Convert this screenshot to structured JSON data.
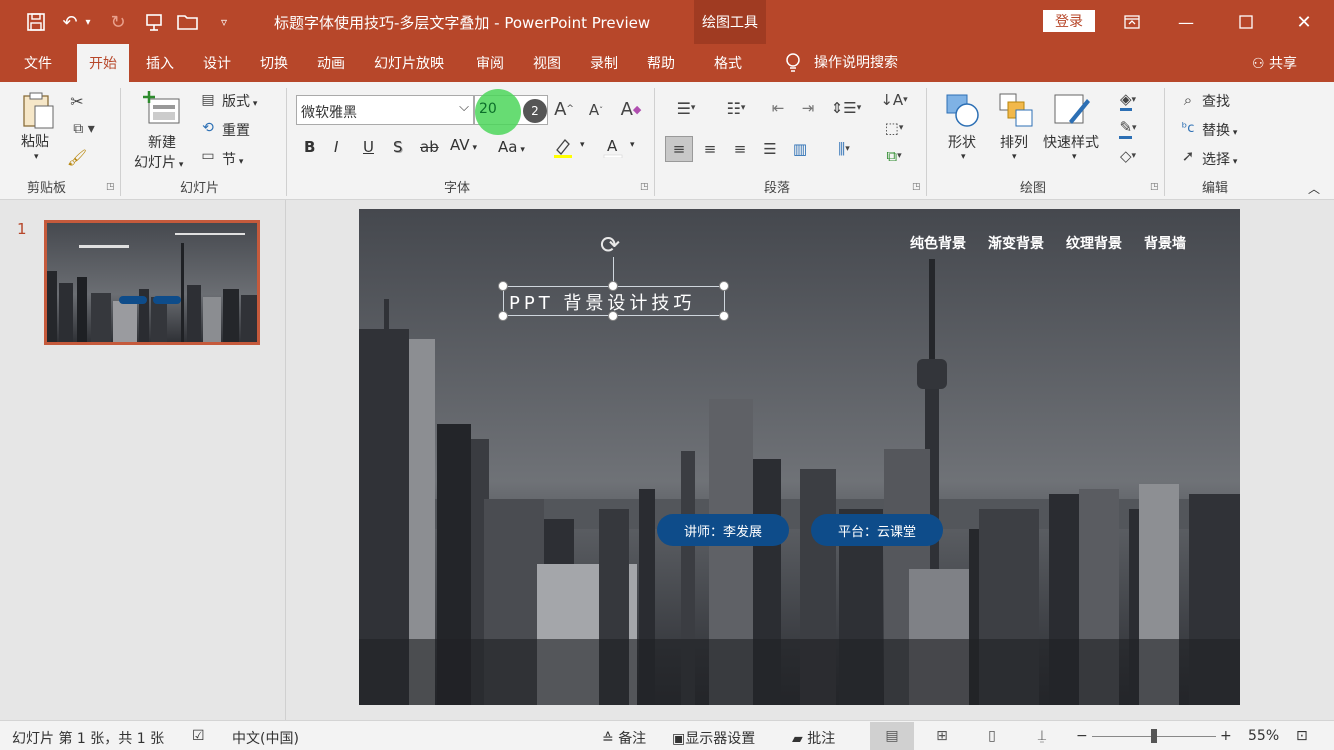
{
  "window": {
    "title": "标题字体使用技巧-多层文字叠加 - PowerPoint Preview",
    "contextual_group": "绘图工具",
    "login_label": "登录"
  },
  "tabs": [
    "文件",
    "开始",
    "插入",
    "设计",
    "切换",
    "动画",
    "幻灯片放映",
    "审阅",
    "视图",
    "录制",
    "帮助",
    "格式"
  ],
  "active_tab": "开始",
  "tell_me": "操作说明搜索",
  "share_label": "共享",
  "ribbon": {
    "clipboard": {
      "label": "剪贴板",
      "paste": "粘贴"
    },
    "slides": {
      "label": "幻灯片",
      "new_slide_1": "新建",
      "new_slide_2": "幻灯片",
      "layout": "版式",
      "reset": "重置",
      "section": "节"
    },
    "font": {
      "label": "字体",
      "family": "微软雅黑",
      "size": "20",
      "step_badge": "2",
      "bold": "B",
      "italic": "I",
      "underline": "U",
      "shadow": "S",
      "strike": "ab",
      "spacing": "AV",
      "case": "Aa"
    },
    "paragraph": {
      "label": "段落"
    },
    "drawing": {
      "label": "绘图",
      "shapes": "形状",
      "arrange": "排列",
      "quick_styles": "快速样式"
    },
    "editing": {
      "label": "编辑",
      "find": "查找",
      "replace": "替换",
      "select": "选择"
    }
  },
  "thumbnail": {
    "number": "1"
  },
  "slide": {
    "nav": [
      "纯色背景",
      "渐变背景",
      "纹理背景",
      "背景墙"
    ],
    "title": "PPT 背景设计技巧",
    "lecturer": "讲师：李发展",
    "platform": "平台：云课堂"
  },
  "status": {
    "slide_info": "幻灯片 第 1 张，共 1 张",
    "language": "中文(中国)",
    "notes": "备注",
    "display_settings": "显示器设置",
    "comments": "批注",
    "zoom": "55%",
    "zoom_fraction": 0.55
  },
  "colors": {
    "accent": "#b7472a",
    "button_blue": "#0e4c8a",
    "highlight_green": "#4cd65a"
  }
}
